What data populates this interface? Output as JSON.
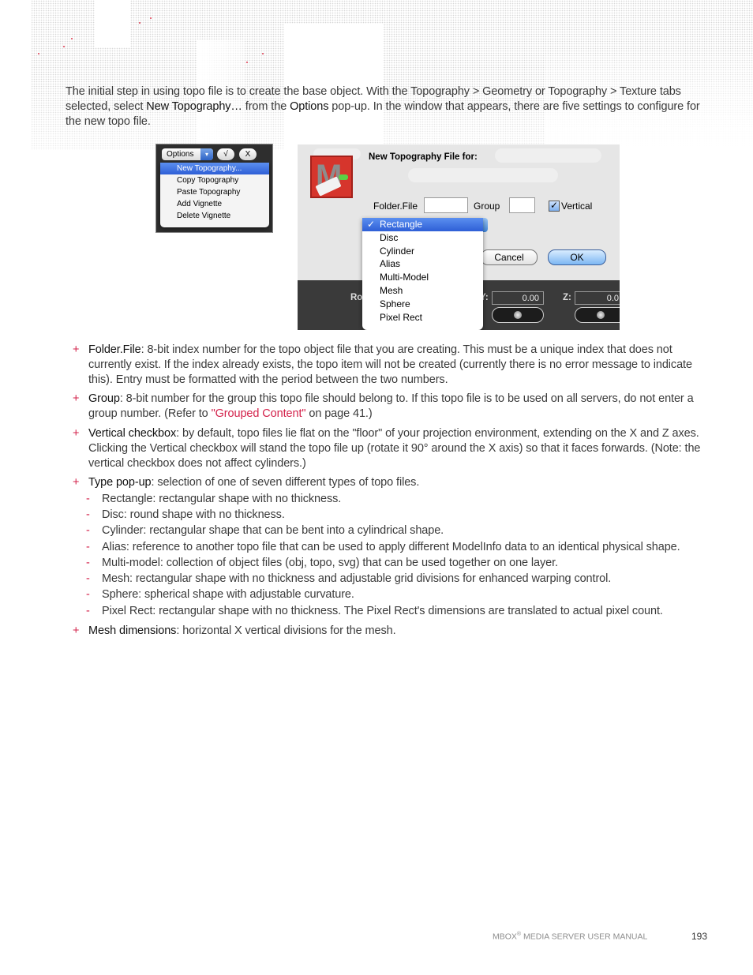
{
  "intro": {
    "text_1": "The initial step in using topo file is to create the base object. With the Topography > Geometry or Topography > Texture tabs selected, select ",
    "bold_1": "New Topography…",
    "text_2": " from the ",
    "bold_2": "Options",
    "text_3": " pop-up. In the window that appears, there are five settings to configure for the new topo file."
  },
  "options_screenshot": {
    "options_button": "Options",
    "arrow_glyph": "▾",
    "check_button": "√",
    "close_button": "X",
    "menu_items": [
      {
        "label": "New Topography...",
        "selected": true
      },
      {
        "label": "Copy Topography",
        "selected": false
      },
      {
        "label": "Paste Topography",
        "selected": false
      },
      {
        "label": "Add Vignette",
        "selected": false
      },
      {
        "label": "Delete Vignette",
        "selected": false
      }
    ]
  },
  "dialog_screenshot": {
    "title": "New Topography File for:",
    "logo_letter": "M",
    "folder_file_label": "Folder.File",
    "folder_file_value": "",
    "group_label": "Group",
    "group_value": "",
    "vertical_label": "Vertical",
    "vertical_checked": true,
    "check_glyph": "✓",
    "cancel_button": "Cancel",
    "ok_button": "OK",
    "type_options": [
      {
        "label": "Rectangle",
        "selected": true
      },
      {
        "label": "Disc",
        "selected": false
      },
      {
        "label": "Cylinder",
        "selected": false
      },
      {
        "label": "Alias",
        "selected": false
      },
      {
        "label": "Multi-Model",
        "selected": false
      },
      {
        "label": "Mesh",
        "selected": false
      },
      {
        "label": "Sphere",
        "selected": false
      },
      {
        "label": "Pixel Rect",
        "selected": false
      }
    ],
    "background": {
      "rot_label": "Rot",
      "y_label": "Y:",
      "y_value": "0.00",
      "z_label": "Z:",
      "z_value": "0.0"
    }
  },
  "bullets": [
    {
      "term": "Folder.File",
      "text": ": 8-bit index number for the topo object file that you are creating. This must be a unique index that does not currently exist. If the index already exists, the topo item will not be created (currently there is no error message to indicate this). Entry must be formatted with the period between the two numbers."
    },
    {
      "term": "Group",
      "text": ": 8-bit number for the group this topo file should belong to. If this topo file is to be used on all servers, do not enter a group number. (Refer to ",
      "link": "\"Grouped Content\"",
      "text_after": " on page 41.)"
    },
    {
      "term": "Vertical checkbox",
      "text": ": by default, topo files lie flat on the \"floor\" of your projection environment, extending on the X and Z axes. Clicking the Vertical checkbox will stand the topo file up (rotate it 90° around the X axis) so that it faces forwards. (Note: the vertical checkbox does not affect cylinders.)"
    },
    {
      "term": "Type pop-up",
      "text": ": selection of one of seven different types of topo files.",
      "sub": [
        "Rectangle: rectangular shape with no thickness.",
        "Disc: round shape with no thickness.",
        "Cylinder: rectangular shape that can be bent into a cylindrical shape.",
        "Alias: reference to another topo file that can be used to apply different ModelInfo data to an identical physical shape.",
        "Multi-model: collection of object files (obj, topo, svg) that can be used together on one layer.",
        "Mesh: rectangular shape with no thickness and adjustable grid divisions for enhanced warping control.",
        "Sphere: spherical shape with adjustable curvature.",
        "Pixel Rect: rectangular shape with no thickness. The Pixel Rect's dimensions are translated to actual pixel count."
      ]
    },
    {
      "term": "Mesh dimensions",
      "text": ": horizontal X vertical divisions for the mesh."
    }
  ],
  "markers": {
    "bullet": "+",
    "sub_bullet": "-"
  },
  "footer": {
    "brand": "MBOX",
    "registered": "®",
    "title": " MEDIA SERVER USER MANUAL",
    "page_number": "193"
  },
  "colors": {
    "accent": "#d3214a",
    "selection": "#2e5fd6",
    "text": "#3a3a3a"
  }
}
